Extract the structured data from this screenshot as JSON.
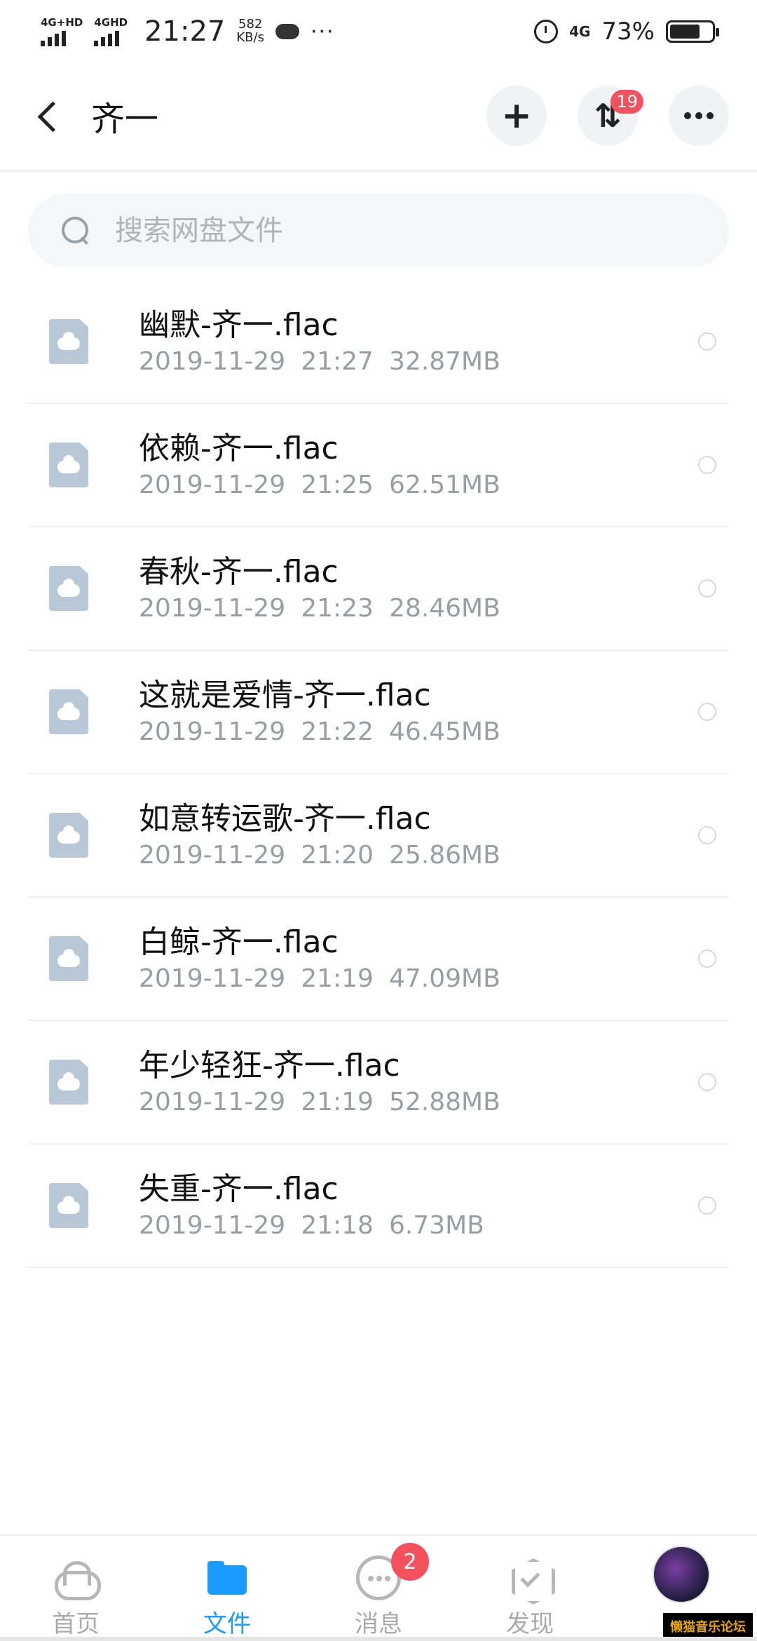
{
  "status_bar": {
    "sim1_label": "4G+HD",
    "sim2_label": "4GHD",
    "time": "21:27",
    "speed_value": "582",
    "speed_unit": "KB/s",
    "network_label": "4G",
    "battery": "73%",
    "battery_level": 0.73
  },
  "header": {
    "title": "齐一",
    "add_glyph": "+",
    "transfer_glyph": "⇅",
    "transfer_badge": "19"
  },
  "search": {
    "placeholder": "搜索网盘文件"
  },
  "files": [
    {
      "name": "幽默-齐一.flac",
      "date": "2019-11-29",
      "time": "21:27",
      "size": "32.87MB"
    },
    {
      "name": "依赖-齐一.flac",
      "date": "2019-11-29",
      "time": "21:25",
      "size": "62.51MB"
    },
    {
      "name": "春秋-齐一.flac",
      "date": "2019-11-29",
      "time": "21:23",
      "size": "28.46MB"
    },
    {
      "name": "这就是爱情-齐一.flac",
      "date": "2019-11-29",
      "time": "21:22",
      "size": "46.45MB"
    },
    {
      "name": "如意转运歌-齐一.flac",
      "date": "2019-11-29",
      "time": "21:20",
      "size": "25.86MB"
    },
    {
      "name": "白鲸-齐一.flac",
      "date": "2019-11-29",
      "time": "21:19",
      "size": "47.09MB"
    },
    {
      "name": "年少轻狂-齐一.flac",
      "date": "2019-11-29",
      "time": "21:19",
      "size": "52.88MB"
    },
    {
      "name": "失重-齐一.flac",
      "date": "2019-11-29",
      "time": "21:18",
      "size": "6.73MB"
    }
  ],
  "tabs": [
    {
      "label": "首页",
      "icon": "home-cloud-icon"
    },
    {
      "label": "文件",
      "icon": "folder-icon",
      "active": true
    },
    {
      "label": "消息",
      "icon": "chat-icon",
      "badge": "2"
    },
    {
      "label": "发现",
      "icon": "discover-icon"
    },
    {
      "icon": "avatar"
    }
  ],
  "watermark": "懒猫音乐论坛",
  "colors": {
    "accent": "#1a9cff",
    "badge": "#f3515e",
    "meta_text": "#9a9da3",
    "file_icon": "#b9c8d6"
  }
}
